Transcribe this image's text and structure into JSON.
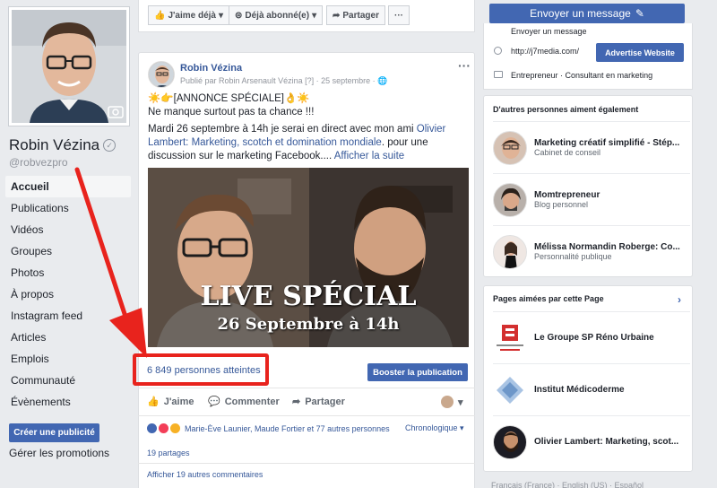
{
  "profile": {
    "name": "Robin Vézina",
    "handle": "@robvezpro"
  },
  "left_nav": {
    "items": [
      {
        "label": "Accueil",
        "active": true
      },
      {
        "label": "Publications"
      },
      {
        "label": "Vidéos"
      },
      {
        "label": "Groupes"
      },
      {
        "label": "Photos"
      },
      {
        "label": "À propos"
      },
      {
        "label": "Instagram feed"
      },
      {
        "label": "Articles"
      },
      {
        "label": "Emplois"
      },
      {
        "label": "Communauté"
      },
      {
        "label": "Évènements"
      }
    ],
    "create_ad_label": "Créer une publicité",
    "manage_promotions_label": "Gérer les promotions"
  },
  "action_bar": {
    "like_label": "J'aime déjà",
    "follow_label": "Déjà abonné(e)",
    "share_label": "Partager",
    "more_label": "···"
  },
  "post": {
    "author": "Robin Vézina",
    "published_by": "Publié par Robin Arsenault Vézina [?] · 25 septembre · ",
    "headline": "☀️👉[ANNONCE SPÉCIALE]👌☀️",
    "line2": "Ne manque surtout pas ta chance !!!",
    "body_prefix": "Mardi 26 septembre à 14h je serai en direct avec mon ami ",
    "body_link": "Olivier Lambert: Marketing, scotch et domination mondiale",
    "body_suffix": ". pour une discussion sur le marketing Facebook.... ",
    "see_more": "Afficher la suite",
    "video_title": "LIVE SPÉCIAL",
    "video_date": "26 Septembre à 14h",
    "reach": "6 849 personnes atteintes",
    "boost_label": "Booster la publication",
    "actions": {
      "like": "J'aime",
      "comment": "Commenter",
      "share": "Partager"
    },
    "reactions_text": "Marie-Ève Launier, Maude Fortier et 77 autres personnes",
    "sort_label": "Chronologique ▾",
    "shares": "19 partages",
    "more_comments": "Afficher 19 autres commentaires"
  },
  "right": {
    "send_message_label": "Envoyer un message",
    "send_message_small": "Envoyer un message",
    "website": "http://j7media.com/",
    "advertise_label": "Advertise Website",
    "categories": "Entrepreneur · Consultant en marketing",
    "also_like_title": "D'autres personnes aiment également",
    "suggestions": [
      {
        "name": "Marketing créatif simplifié - Stép...",
        "category": "Cabinet de conseil"
      },
      {
        "name": "Momtrepreneur",
        "category": "Blog personnel"
      },
      {
        "name": "Mélissa Normandin Roberge: Co...",
        "category": "Personnalité publique"
      }
    ],
    "pages_liked_title": "Pages aimées par cette Page",
    "liked_pages": [
      {
        "name": "Le Groupe SP Réno Urbaine"
      },
      {
        "name": "Institut Médicoderme"
      },
      {
        "name": "Olivier Lambert: Marketing, scot..."
      }
    ],
    "footer": "Français (France) · English (US) · Español"
  },
  "colors": {
    "fb_blue": "#4267b2",
    "link_blue": "#365899",
    "highlight_red": "#e8231d",
    "background": "#e9ebee"
  }
}
